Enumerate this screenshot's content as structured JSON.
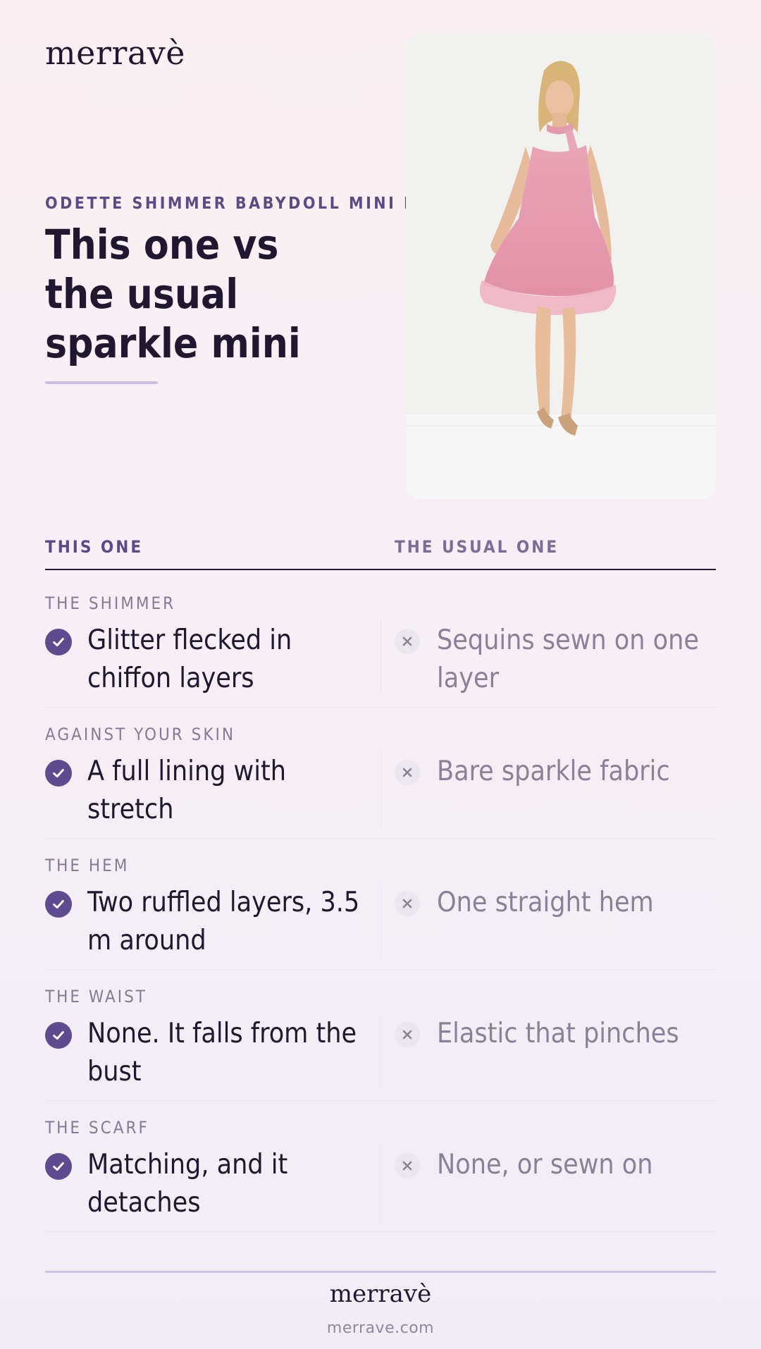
{
  "brand": {
    "logo": "merravè"
  },
  "header": {
    "eyebrow": "ODETTE SHIMMER BABYDOLL MINI D",
    "title": "This one vs the usual sparkle mini"
  },
  "columns": {
    "left": "THIS ONE",
    "right": "THE USUAL ONE"
  },
  "rows": [
    {
      "label": "THE SHIMMER",
      "this": "Glitter flecked in chiffon layers",
      "usual": "Sequins sewn on one layer"
    },
    {
      "label": "AGAINST YOUR SKIN",
      "this": "A full lining with stretch",
      "usual": "Bare sparkle fabric"
    },
    {
      "label": "THE HEM",
      "this": "Two ruffled layers, 3.5 m around",
      "usual": "One straight hem"
    },
    {
      "label": "THE WAIST",
      "this": "None. It falls from the bust",
      "usual": "Elastic that pinches"
    },
    {
      "label": "THE SCARF",
      "this": "Matching, and it detaches",
      "usual": "None, or sewn on"
    }
  ],
  "footer": {
    "logo": "merravè",
    "url": "merrave.com"
  },
  "colors": {
    "accent": "#5e4a8e",
    "text": "#1f1830",
    "muted": "#8a8198",
    "dress": "#e8a2b4"
  }
}
